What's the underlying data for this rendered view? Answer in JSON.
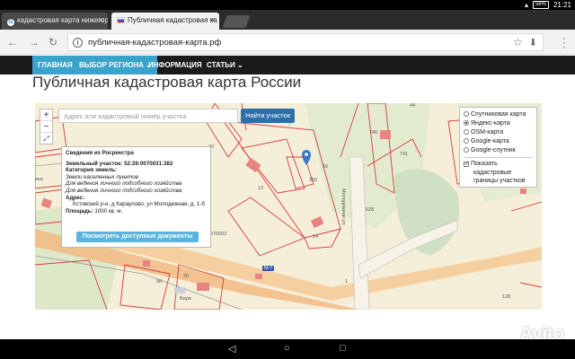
{
  "statusbar": {
    "battery": "58%",
    "time": "21:21"
  },
  "tabs": [
    {
      "title": "кадастровая карта нижегор",
      "icon": "google-icon"
    },
    {
      "title": "Публичная кадастровая ка",
      "icon": "russia-flag-icon"
    }
  ],
  "omnibox": {
    "url": "публичная-кадастровая-карта.рф"
  },
  "sitenav": [
    "ГЛАВНАЯ",
    "ВЫБОР РЕГИОНА ⌄",
    "ИНФОРМАЦИЯ",
    "СТАТЬИ ⌄"
  ],
  "page": {
    "title": "Публичная кадастровая карта России"
  },
  "map": {
    "search_placeholder": "Адрес или кадастровый номер участка",
    "search_button": "Найти участок",
    "zoom_in": "+",
    "zoom_out": "−",
    "fullscreen": "⤢",
    "popup": {
      "title": "Сведения из Росреестра",
      "parcel_label": "Земельный участок:",
      "parcel_value": "52:26:0070031:382",
      "category_label": "Категория земель:",
      "category_value": "Земли населенных пунктов",
      "use1": "Для ведения личного подсобного хозяйства",
      "use2": "Для ведения личного подсобного хозяйства",
      "address_label": "Адрес:",
      "address_value": "Кстовский р-н, д Караулово, ул Молодежная, д. 1-б",
      "area_label": "Площадь:",
      "area_value": "1000 кв. м.",
      "button": "Посмотреть доступные документы"
    },
    "layers": [
      {
        "label": "Спутниковая карта",
        "selected": false
      },
      {
        "label": "Яндекс-карта",
        "selected": true
      },
      {
        "label": "OSM-карта",
        "selected": false
      },
      {
        "label": "Google-карта",
        "selected": false
      },
      {
        "label": "Google-спутник",
        "selected": false
      }
    ],
    "overlay_checkbox": {
      "line1": "Показать",
      "line2": "кадастровые",
      "line3": "границы участков",
      "checked": true
    },
    "labels": {
      "n32": "32",
      "n16": "16",
      "n382": "382",
      "n14": "14",
      "n13": "13",
      "n746": "746",
      "n741": "741",
      "n44": "44",
      "n1": "1",
      "n7": "7",
      "road_code": "070002",
      "m7": "М-7",
      "street": "Молодежная ул.",
      "n96": "96",
      "n20": "20",
      "n628": "628",
      "n128": "128",
      "vira": "Вира",
      "ika": "ика"
    }
  },
  "watermark": "Avito"
}
